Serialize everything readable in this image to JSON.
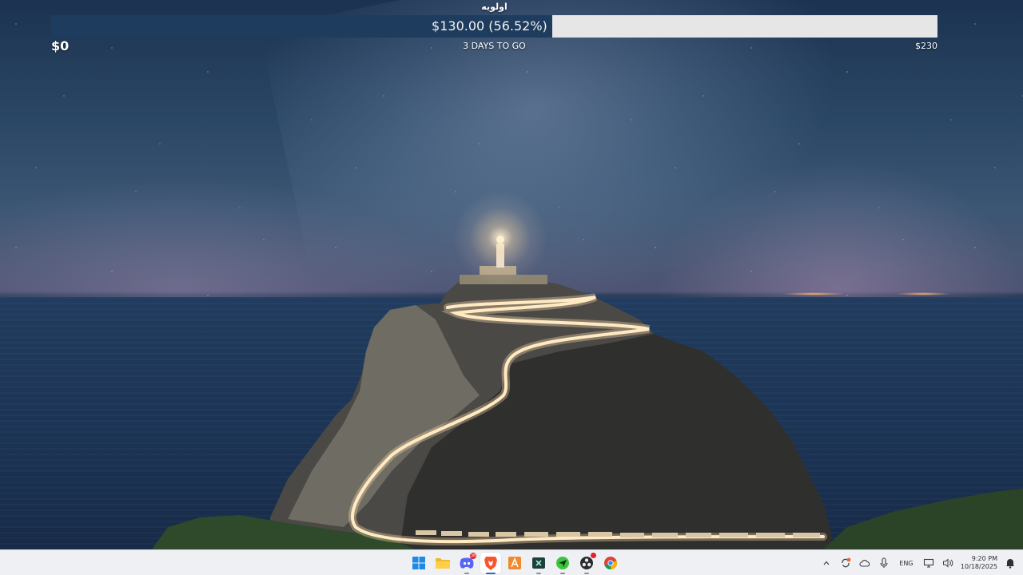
{
  "goal_widget": {
    "title": "اولویه",
    "progress_label": "$130.00 (56.52%)",
    "raised": 130,
    "goal": 230,
    "progress_percent": 56.52,
    "start_label": "$0",
    "end_label": "$230",
    "remaining_label": "3 DAYS TO GO",
    "fill_color": "#1e3c5e",
    "track_color": "#e6e6e6"
  },
  "taskbar": {
    "apps": [
      {
        "name": "start-button",
        "icon": "windows-logo-icon",
        "active": false,
        "running": false
      },
      {
        "name": "file-explorer",
        "icon": "folder-icon",
        "active": false,
        "running": false
      },
      {
        "name": "discord",
        "icon": "discord-icon",
        "active": false,
        "running": true,
        "badge": "38"
      },
      {
        "name": "brave-browser",
        "icon": "brave-lion-icon",
        "active": true,
        "running": true
      },
      {
        "name": "altium-app",
        "icon": "orange-a-icon",
        "active": false,
        "running": false
      },
      {
        "name": "terminal-app",
        "icon": "terminal-x-icon",
        "active": false,
        "running": true
      },
      {
        "name": "green-app",
        "icon": "green-plane-icon",
        "active": false,
        "running": true
      },
      {
        "name": "obs-studio",
        "icon": "obs-icon",
        "active": false,
        "running": true,
        "badge": ""
      },
      {
        "name": "chrome-browser",
        "icon": "chrome-icon",
        "active": false,
        "running": false
      }
    ],
    "tray": {
      "language": "ENG",
      "time": "9:20 PM",
      "date": "10/18/2025"
    }
  }
}
